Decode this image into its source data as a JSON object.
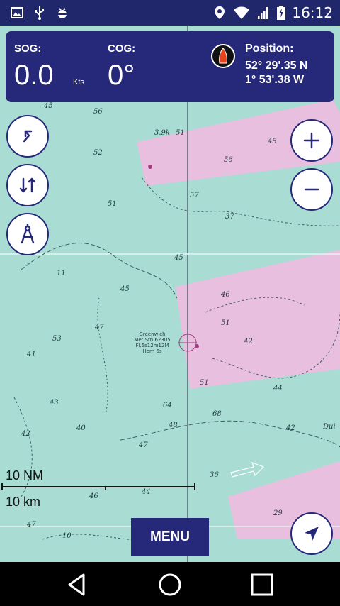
{
  "status_bar": {
    "time": "16:12",
    "left_icons": [
      "image-icon",
      "usb-icon",
      "android-debug-icon"
    ],
    "right_icons": [
      "location-icon",
      "wifi-icon",
      "signal-icon",
      "battery-charging-icon"
    ]
  },
  "info_panel": {
    "sog_label": "SOG:",
    "sog_value": "0.0",
    "sog_unit": "Kts",
    "cog_label": "COG:",
    "cog_value": "0°",
    "position_label": "Position:",
    "latitude": "52° 29'.35 N",
    "longitude": "1° 53'.38 W"
  },
  "map": {
    "depths": [
      "45",
      "56",
      "3.9k",
      "51",
      "52",
      "56",
      "45",
      "57",
      "51",
      "37",
      "45",
      "11",
      "45",
      "47",
      "53",
      "46",
      "51",
      "42",
      "53",
      "41",
      "42",
      "44",
      "43",
      "64",
      "68",
      "48",
      "40",
      "42",
      "47",
      "44",
      "46",
      "36",
      "47",
      "10",
      "29",
      "Dui"
    ],
    "marker_label": "Greenwich\nMet Stn 62305\nFl.5s12m12M\nHorn 6s"
  },
  "scale": {
    "nm_label": "10 NM",
    "km_label": "10 km"
  },
  "buttons": {
    "menu_label": "MENU"
  },
  "colors": {
    "sea": "#a9dcd3",
    "restricted_area": "#e9bfe0",
    "brand": "#26297a",
    "status_bar": "#21276b"
  }
}
